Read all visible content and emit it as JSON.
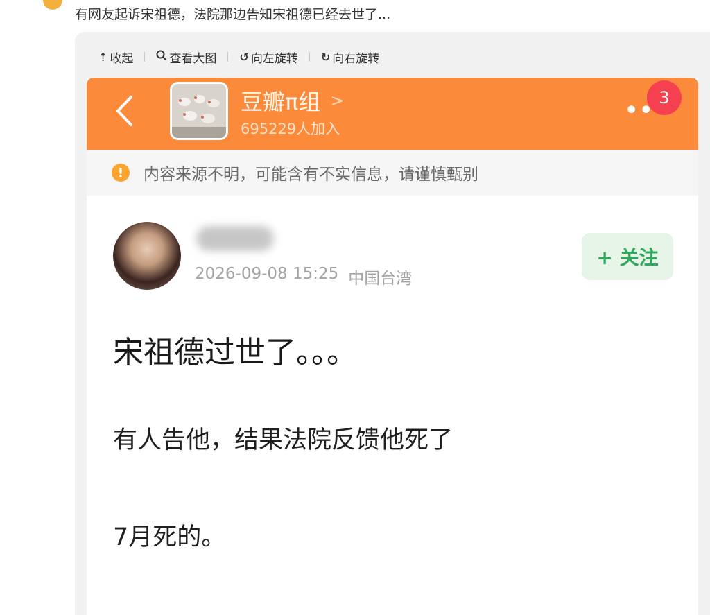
{
  "caption": "有网友起诉宋祖德，法院那边告知宋祖德已经去世了...",
  "toolbar": {
    "collapse": "收起",
    "view_large": "查看大图",
    "rotate_left": "向左旋转",
    "rotate_right": "向右旋转"
  },
  "group": {
    "name": "豆瓣π组",
    "members": "695229人加入",
    "notification_count": "3"
  },
  "notice": "内容来源不明，可能含有不实信息，请谨慎甄别",
  "post": {
    "datetime": "2026-09-08 15:25",
    "location": "中国台湾",
    "follow_label": "+ 关注",
    "title": "宋祖德过世了。。。",
    "line1": "有人告他，结果法院反馈他死了",
    "line2": "7月死的。"
  },
  "colors": {
    "header": "#fb8b3a",
    "badge": "#f5404f",
    "follow_text": "#2ea85b",
    "follow_bg": "#e6f5e8",
    "notice_icon": "#fba430"
  },
  "icons": [
    "collapse-icon",
    "search-icon",
    "rotate-left-icon",
    "rotate-right-icon",
    "back-icon",
    "chevron-right-icon",
    "more-icon",
    "warning-icon"
  ]
}
